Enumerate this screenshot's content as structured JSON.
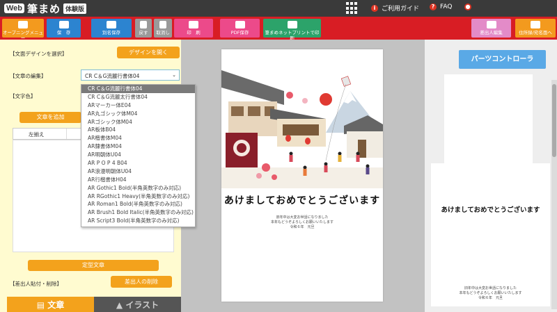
{
  "header": {
    "logo_web": "Web",
    "logo_name": "筆まめ",
    "logo_badge": "体験版",
    "guide_label": "ご利用ガイド",
    "faq_label": "FAQ"
  },
  "toolbar": {
    "opening_menu": "オープニングメニュー",
    "save": "保　存",
    "save_as": "別名保存",
    "undo": "戻す",
    "redo": "取消し",
    "print": "印　刷",
    "pdf_save": "PDF保存",
    "net_print": "筆まめネットプリントで印刷",
    "sender_edit": "差出人編集",
    "address_side": "住所録/宛名面へ"
  },
  "left_panel": {
    "design_label": "【文面デザインを選択】",
    "open_design_button": "デザインを開く",
    "text_edit_label": "【文章の編集】",
    "font_select_value": "CR C＆G流麗行書体04",
    "text_color_label": "【文字色】",
    "add_text_button": "文章を追加",
    "align_left": "左揃え",
    "standard_text_button": "定型文章",
    "sender_label": "【差出人貼付・削除】",
    "delete_sender_button": "差出人の削除",
    "tab_text": "文章",
    "tab_illust": "イラスト"
  },
  "font_options": [
    "CR C＆G流麗行書体04",
    "CR C＆G流麗太行書体04",
    "ARマーカー体E04",
    "AR丸ゴシック体M04",
    "ARゴシック体M04",
    "AR板体B04",
    "AR楷書体M04",
    "AR隷書体M04",
    "AR明朝体U04",
    "AR P O P 4 B04",
    "AR浪漫明朝体U04",
    "AR行楷書体H04",
    "AR Gothic1 Bold(半角英数字のみ対応)",
    "AR RGothic1 Heavy(半角英数字のみ対応)",
    "AR Roman1 Bold(半角英数字のみ対応)",
    "AR Brush1 Bold Italic(半角英数字のみ対応)",
    "AR Script3 Bold(半角英数字のみ対応)"
  ],
  "card": {
    "greeting": "あけましておめでとうございます",
    "line1": "旧年中は大変お世話になりました",
    "line2": "本年もどうぞよろしくお願いいたします",
    "line3": "令和６年　元旦"
  },
  "right_panel": {
    "parts_controller_button": "パーツコントローラ",
    "greeting": "あけましておめでとうございます",
    "line1": "旧年中は大変お世話になりました",
    "line2": "本年もどうぞよろしくお願いいたします",
    "line3": "令和６年　元旦"
  },
  "colors": {
    "toolbar_red": "#d81d24",
    "accent_orange": "#f3a21c",
    "panel_yellow": "#fffbd0",
    "parts_blue": "#5aa9e6"
  }
}
